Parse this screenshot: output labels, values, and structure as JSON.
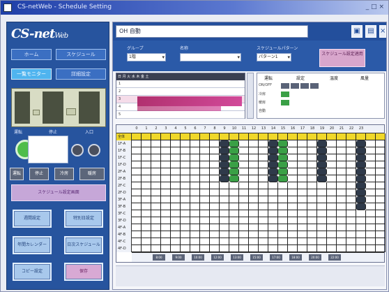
{
  "window": {
    "title": "CS-netWeb - Schedule Setting",
    "controls": "_ □ ×"
  },
  "sidebar": {
    "logo_main": "CS-net",
    "logo_sub": "Web",
    "buttons_row1": [
      "ホーム",
      "スケジュール"
    ],
    "buttons_row2": [
      "一覧モニター",
      "詳細設定"
    ],
    "status_labels": [
      "運転",
      "停止",
      "入口"
    ],
    "square_buttons": [
      "運転",
      "停止",
      "冷房",
      "暖房"
    ],
    "pink_label": "スケジュール設定画面",
    "actions": [
      {
        "label": "週間設定",
        "style": "blue"
      },
      {
        "label": "特別日設定",
        "style": "blue"
      },
      {
        "label": "年間カレンダー",
        "style": "blue"
      },
      {
        "label": "日次スケジュール",
        "style": "blue"
      },
      {
        "label": "コピー設定",
        "style": "blue"
      },
      {
        "label": "保存",
        "style": "pink"
      }
    ]
  },
  "header": {
    "title": "OH 自動",
    "icons": [
      "save-icon",
      "print-icon",
      "close-icon"
    ]
  },
  "filters": {
    "group_label": "グループ",
    "group_value": "1階",
    "name_label": "名称",
    "name_value": "",
    "pattern_label": "スケジュールパターン",
    "pattern_value": "パターン1",
    "apply_button": "スケジュール設定適用"
  },
  "mini_table": {
    "header": "日 月 火 水 木 金 土",
    "rows": [
      "1",
      "2",
      "3",
      "4",
      "5"
    ]
  },
  "legend": {
    "headers": [
      "運転",
      "設定",
      "温度",
      "風量"
    ],
    "rows": [
      "ON/OFF",
      "冷房",
      "暖房",
      "自動"
    ],
    "colors": {
      "on": "#3aa046",
      "off": "#5a6378",
      "yellow": "#f0d82a"
    }
  },
  "schedule_grid": {
    "hours": [
      "0",
      "1",
      "2",
      "3",
      "4",
      "5",
      "6",
      "7",
      "8",
      "9",
      "10",
      "11",
      "12",
      "13",
      "14",
      "15",
      "16",
      "17",
      "18",
      "19",
      "20",
      "21",
      "22",
      "23"
    ],
    "rows": [
      "全体",
      "1F-A",
      "1F-B",
      "1F-C",
      "1F-D",
      "2F-A",
      "2F-B",
      "2F-C",
      "2F-D",
      "3F-A",
      "3F-B",
      "3F-C",
      "3F-D",
      "4F-A",
      "4F-B",
      "4F-C",
      "4F-D"
    ],
    "foot_tags": [
      "8:00",
      "9:00",
      "10:00",
      "12:00",
      "13:00",
      "15:00",
      "17:00",
      "18:00",
      "20:00",
      "22:00"
    ]
  },
  "status": {
    "text": ""
  }
}
